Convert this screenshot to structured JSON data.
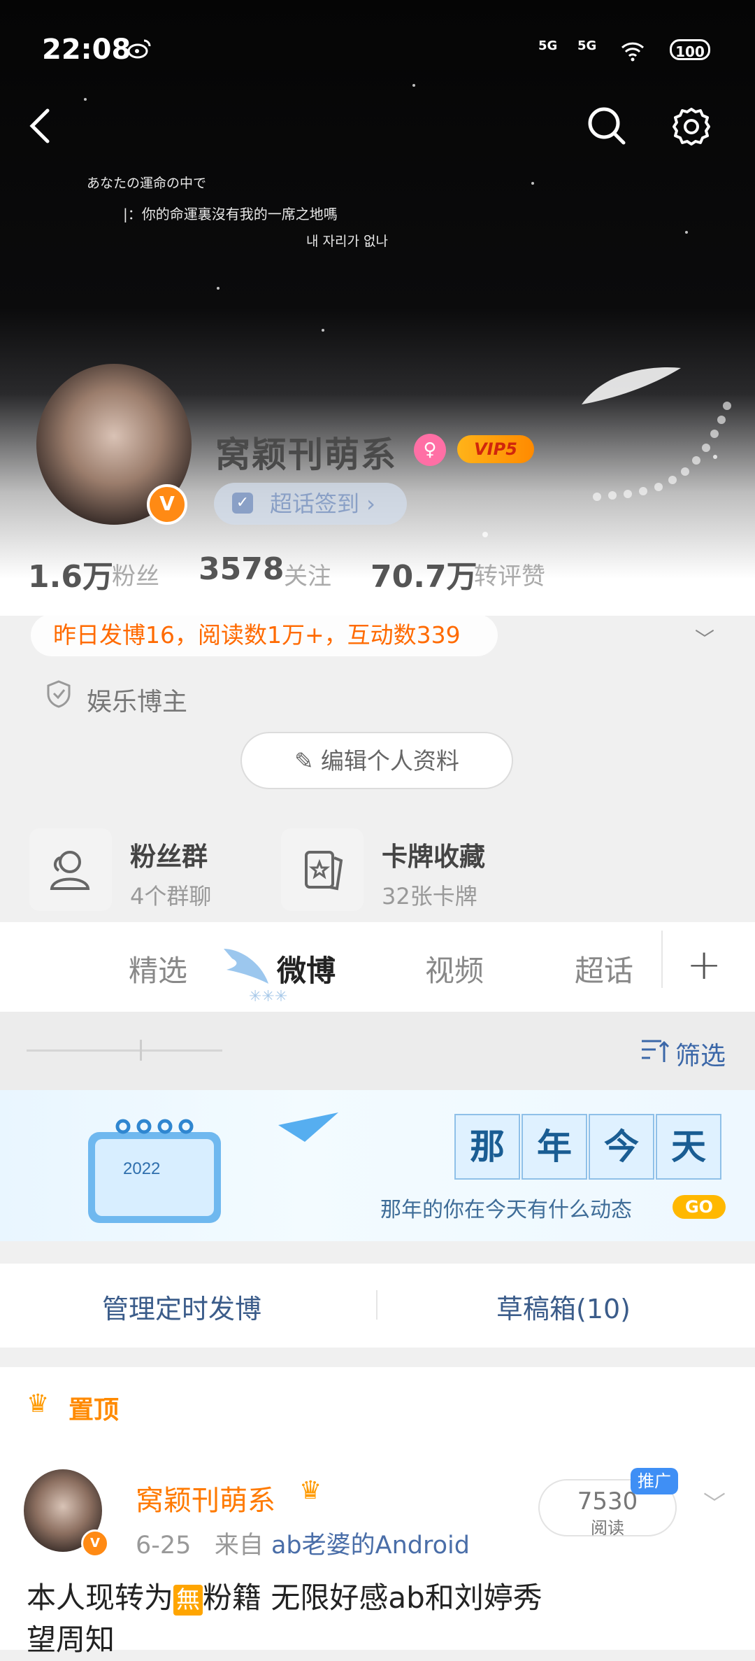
{
  "status_bar": {
    "time": "22:08",
    "signal_1": "5G",
    "signal_2": "5G",
    "battery": "100"
  },
  "banner": {
    "line1": "あなたの運命の中で",
    "line2": "|：你的命運裏沒有我的一席之地嗎",
    "line3": "내 자리가 없나"
  },
  "profile": {
    "username": "窝颖刊萌系",
    "verified_badge": "V",
    "vip_label": "VIP5",
    "supertopic_checkin": "超话签到 ›",
    "stats": [
      {
        "value": "1.6万",
        "label": "粉丝"
      },
      {
        "value": "3578",
        "label": "关注"
      },
      {
        "value": "70.7万",
        "label": "转评赞"
      }
    ],
    "daily_summary": "昨日发博16，阅读数1万+，互动数339",
    "role": "娱乐博主",
    "edit_profile": "编辑个人资料"
  },
  "cards": [
    {
      "title": "粉丝群",
      "subtitle": "4个群聊",
      "icon": "people-icon"
    },
    {
      "title": "卡牌收藏",
      "subtitle": "32张卡牌",
      "icon": "card-icon"
    }
  ],
  "tabs": [
    {
      "label": "精选"
    },
    {
      "label": "微博"
    },
    {
      "label": "视频"
    },
    {
      "label": "超话"
    }
  ],
  "tab_add": "+",
  "filter": {
    "label": "筛选"
  },
  "ad_banner": {
    "chars": [
      "那",
      "年",
      "今",
      "天"
    ],
    "subtitle": "那年的你在今天有什么动态",
    "go": "GO",
    "calendar_year": "2022"
  },
  "actions": {
    "schedule": "管理定时发博",
    "drafts": "草稿箱(10)"
  },
  "pinned_post": {
    "pin_label": "置顶",
    "author": "窝颖刊萌系",
    "date": "6-25",
    "source_prefix": "来自",
    "source": "ab老婆的Android",
    "reads": "7530",
    "reads_label": "阅读",
    "promo": "推广",
    "text_before": "本人现转为",
    "badge": "無",
    "text_after": "粉籍 无限好感ab和刘婷秀",
    "text_line2": "望周知"
  },
  "colors": {
    "accent_orange": "#ff7a00",
    "link_blue": "#3b67a8",
    "vip_gold": "#ffb319"
  }
}
